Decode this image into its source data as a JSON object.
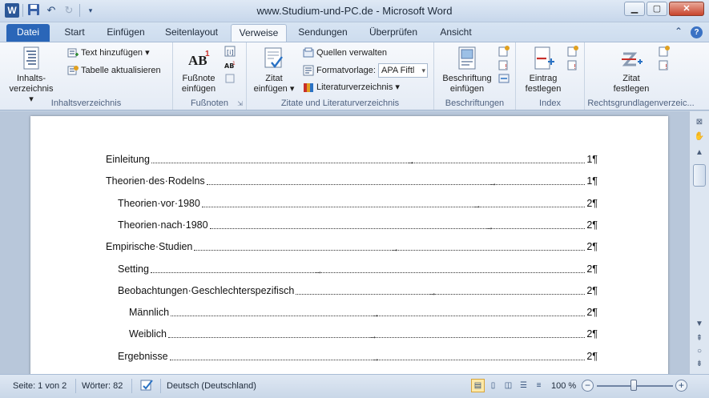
{
  "window": {
    "title": "www.Studium-und-PC.de - Microsoft Word",
    "app_icon": "W",
    "controls": [
      "minimize-icon",
      "maximize-icon",
      "close-icon"
    ]
  },
  "qat": {
    "icons": [
      "save-icon",
      "undo-icon",
      "redo-icon",
      "customize-icon"
    ]
  },
  "tabs": [
    {
      "label": "Datei"
    },
    {
      "label": "Start"
    },
    {
      "label": "Einfügen"
    },
    {
      "label": "Seitenlayout"
    },
    {
      "label": "Verweise"
    },
    {
      "label": "Sendungen"
    },
    {
      "label": "Überprüfen"
    },
    {
      "label": "Ansicht"
    }
  ],
  "active_tab": "Verweise",
  "ribbon": {
    "inhalt": {
      "label": "Inhaltsverzeichnis",
      "big_button": {
        "line1": "Inhalts-",
        "line2": "verzeichnis ▾"
      },
      "text_hinzu": "Text hinzufügen ▾",
      "tabelle_akt": "Tabelle aktualisieren"
    },
    "fussnoten": {
      "label": "Fußnoten",
      "big_button": {
        "line1": "Fußnote",
        "line2": "einfügen"
      }
    },
    "zitate": {
      "label": "Zitate und Literaturverzeichnis",
      "big_button": {
        "line1": "Zitat",
        "line2": "einfügen ▾"
      },
      "quellen": "Quellen verwalten",
      "formatvorlage": "Formatvorlage:",
      "formatvorlage_value": "APA Fiftl",
      "literatur": "Literaturverzeichnis ▾"
    },
    "beschriftungen": {
      "label": "Beschriftungen",
      "big_button": {
        "line1": "Beschriftung",
        "line2": "einfügen"
      }
    },
    "index": {
      "label": "Index",
      "big_button": {
        "line1": "Eintrag",
        "line2": "festlegen"
      }
    },
    "rechts": {
      "label": "Rechtsgrundlagenverzeic...",
      "big_button": {
        "line1": "Zitat",
        "line2": "festlegen"
      }
    }
  },
  "toc": [
    {
      "text": "Einleitung",
      "page": "1¶",
      "level": 1
    },
    {
      "text": "Theorien·des·Rodelns",
      "page": "1¶",
      "level": 1
    },
    {
      "text": "Theorien·vor·1980",
      "page": "2¶",
      "level": 2
    },
    {
      "text": "Theorien·nach·1980",
      "page": "2¶",
      "level": 2
    },
    {
      "text": "Empirische·Studien",
      "page": "2¶",
      "level": 1
    },
    {
      "text": "Setting",
      "page": "2¶",
      "level": 2
    },
    {
      "text": "Beobachtungen·Geschlechterspezifisch",
      "page": "2¶",
      "level": 2
    },
    {
      "text": "Männlich",
      "page": "2¶",
      "level": 3
    },
    {
      "text": "Weiblich",
      "page": "2¶",
      "level": 3
    },
    {
      "text": "Ergebnisse",
      "page": "2¶",
      "level": 2
    }
  ],
  "status": {
    "page": "Seite: 1 von 2",
    "words": "Wörter: 82",
    "language": "Deutsch (Deutschland)",
    "zoom": "100 %",
    "zoom_minus": "−",
    "zoom_plus": "+"
  },
  "tab_right_icons": [
    "collapse-ribbon-icon",
    "help-icon"
  ]
}
